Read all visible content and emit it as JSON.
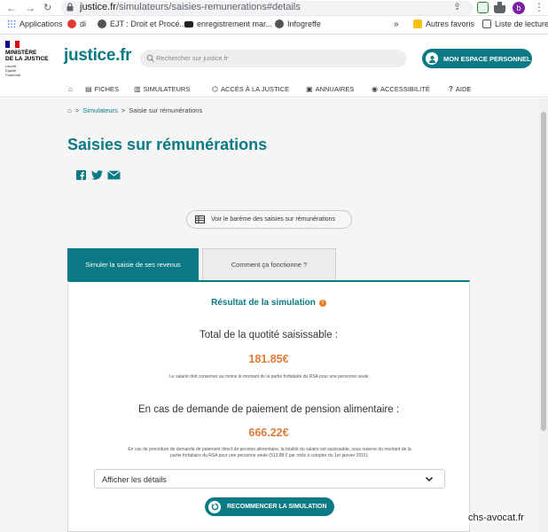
{
  "browser": {
    "url_host": "justice.fr",
    "url_path": "/simulateurs/saisies-remunerations#details",
    "avatar_letter": "b"
  },
  "bookmarks": {
    "items": [
      {
        "label": "Applications"
      },
      {
        "label": "di"
      },
      {
        "label": "EJT : Droit et Procé..."
      },
      {
        "label": "enregistrement mar..."
      },
      {
        "label": "Infogreffe"
      },
      {
        "label": "Autres favoris"
      },
      {
        "label": "Liste de lecture"
      }
    ],
    "overflow": "»"
  },
  "header": {
    "ministere_line1": "MINISTÈRE",
    "ministere_line2": "DE LA JUSTICE",
    "devise": [
      "Liberté",
      "Égalité",
      "Fraternité"
    ],
    "logo": "justice.fr",
    "search_placeholder": "Rechercher sur justice.fr",
    "espace_button": "MON ESPACE PERSONNEL"
  },
  "nav": {
    "items": [
      {
        "label": "FICHES"
      },
      {
        "label": "SIMULATEURS"
      },
      {
        "label": "ACCÈS À LA JUSTICE"
      },
      {
        "label": "ANNUAIRES"
      },
      {
        "label": "ACCESSIBILITÉ"
      },
      {
        "label": "AIDE"
      }
    ]
  },
  "breadcrumb": {
    "separator": ">",
    "link": "Simulateurs",
    "current": "Saisie sur rémunérations"
  },
  "page": {
    "title": "Saisies sur rémunérations",
    "bareme_button": "Voir le barème des saisies sur rémunérations"
  },
  "tabs": [
    {
      "label": "Simuler la saisie de ses revenus",
      "active": true
    },
    {
      "label": "Comment ça fonctionne ?",
      "active": false
    }
  ],
  "result": {
    "title": "Résultat de la simulation",
    "info_symbol": "!",
    "total_label": "Total de la quotité saisissable :",
    "total_amount": "181.85€",
    "total_note": "Le salarié doit conserver au moins le montant de la partie forfaitaire du RSA pour une personne seule.",
    "pension_label": "En cas de demande de paiement de pension alimentaire :",
    "pension_amount": "666.22€",
    "pension_note_line1": "En cas de procédure de demande de paiement direct de pension alimentaire, la totalité du salaire est saisissable, sous reserve du montant de la",
    "pension_note_line2": "partie forfaitaire du RSA pour une personne seule (513,88 € par mois à compter du 1er janvier 2015).",
    "details_label": "Afficher les détails",
    "restart_button": "RECOMMENCER LA SIMULATION"
  },
  "watermark": "chs-avocat.fr",
  "colors": {
    "brand": "#0b7a84",
    "amount": "#e07b39",
    "info": "#e67e22"
  }
}
